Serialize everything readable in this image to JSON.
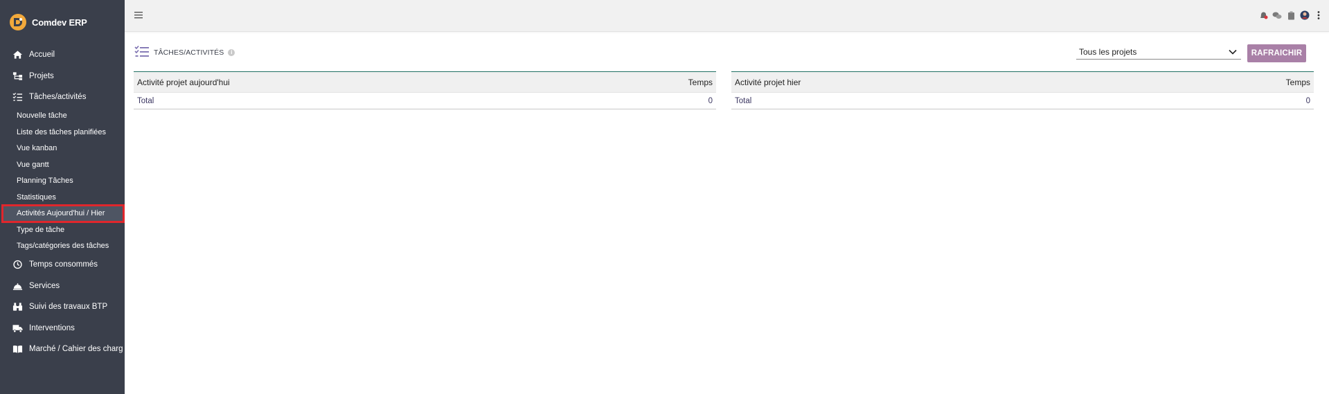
{
  "app": {
    "title": "Comdev ERP"
  },
  "sidebar": {
    "items": [
      {
        "label": "Accueil",
        "icon": "home-icon"
      },
      {
        "label": "Projets",
        "icon": "sitemap-icon"
      },
      {
        "label": "Tâches/activités",
        "icon": "tasks-icon"
      }
    ],
    "subitems": [
      {
        "label": "Nouvelle tâche"
      },
      {
        "label": "Liste des tâches planifiées"
      },
      {
        "label": "Vue kanban"
      },
      {
        "label": "Vue gantt"
      },
      {
        "label": "Planning Tâches"
      },
      {
        "label": "Statistiques"
      },
      {
        "label": "Activités Aujourd'hui / Hier",
        "active": true
      },
      {
        "label": "Type de tâche"
      },
      {
        "label": "Tags/catégories des tâches"
      }
    ],
    "items_after": [
      {
        "label": "Temps consommés",
        "icon": "clock-icon"
      },
      {
        "label": "Services",
        "icon": "service-bell-icon"
      },
      {
        "label": "Suivi des travaux BTP",
        "icon": "binoculars-icon"
      },
      {
        "label": "Interventions",
        "icon": "truck-icon"
      },
      {
        "label": "Marché / Cahier des charg",
        "icon": "book-icon"
      }
    ]
  },
  "page": {
    "title": "TÂCHES/ACTIVITÉS",
    "info_icon": "i",
    "project_filter": "Tous les projets",
    "refresh_label": "RAFRAICHIR"
  },
  "tables": {
    "today": {
      "col1": "Activité projet aujourd'hui",
      "col2": "Temps",
      "total_label": "Total",
      "total_value": "0"
    },
    "yesterday": {
      "col1": "Activité projet hier",
      "col2": "Temps",
      "total_label": "Total",
      "total_value": "0"
    }
  },
  "colors": {
    "sidebar_bg": "#3a3f4b",
    "accent_button": "#a980a7",
    "table_border": "#1f6f63",
    "highlight": "#e0262c",
    "link_text": "#3a3560"
  }
}
